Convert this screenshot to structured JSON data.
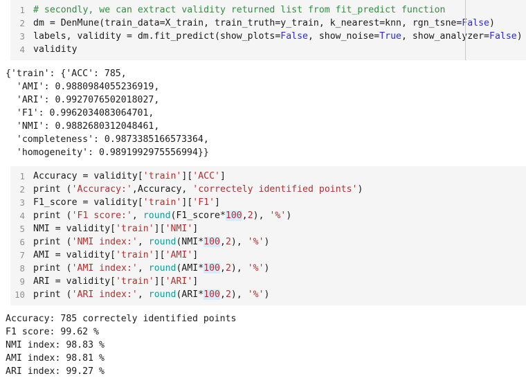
{
  "notebook": {
    "cells": [
      {
        "type": "code",
        "name": "code-cell-1",
        "has_ruler": true,
        "lines": [
          {
            "number": "1",
            "tokens": [
              {
                "t": "# secondly, we can extract validity returned list from fit_predict function",
                "c": "com"
              }
            ]
          },
          {
            "number": "2",
            "tokens": [
              {
                "t": "dm = DenMune(train_data=X_train, train_truth=y_train, k_nearest=knn, rgn_tsne=",
                "c": "pl"
              },
              {
                "t": "False",
                "c": "kw"
              },
              {
                "t": ")",
                "c": "pl"
              }
            ]
          },
          {
            "number": "3",
            "tokens": [
              {
                "t": "labels, validity = dm.fit_predict(show_plots=",
                "c": "pl"
              },
              {
                "t": "False",
                "c": "kw"
              },
              {
                "t": ", show_noise=",
                "c": "pl"
              },
              {
                "t": "True",
                "c": "kw"
              },
              {
                "t": ", show_analyzer=",
                "c": "pl"
              },
              {
                "t": "False",
                "c": "kw"
              },
              {
                "t": ")",
                "c": "pl"
              }
            ]
          },
          {
            "number": "4",
            "tokens": [
              {
                "t": "validity",
                "c": "pl"
              }
            ]
          }
        ]
      },
      {
        "type": "output",
        "name": "output-1",
        "lines": [
          "{'train': {'ACC': 785,",
          "  'AMI': 0.9880984055236919,",
          "  'ARI': 0.9927076502018027,",
          "  'F1': 0.9962034083064701,",
          "  'NMI': 0.9882680312048461,",
          "  'completeness': 0.9873385166573364,",
          "  'homogeneity': 0.9891992975556994}}"
        ]
      },
      {
        "type": "code",
        "name": "code-cell-2",
        "has_ruler": false,
        "lines": [
          {
            "number": "1",
            "tokens": [
              {
                "t": "Accuracy = validity[",
                "c": "pl"
              },
              {
                "t": "'train'",
                "c": "str"
              },
              {
                "t": "][",
                "c": "pl"
              },
              {
                "t": "'ACC'",
                "c": "str"
              },
              {
                "t": "]",
                "c": "pl"
              }
            ]
          },
          {
            "number": "2",
            "tokens": [
              {
                "t": "print (",
                "c": "pl"
              },
              {
                "t": "'Accuracy:'",
                "c": "str"
              },
              {
                "t": ",Accuracy, ",
                "c": "pl"
              },
              {
                "t": "'correctely identified points'",
                "c": "str"
              },
              {
                "t": ")",
                "c": "pl"
              }
            ]
          },
          {
            "number": "3",
            "tokens": [
              {
                "t": "F1_score = validity[",
                "c": "pl"
              },
              {
                "t": "'train'",
                "c": "str"
              },
              {
                "t": "][",
                "c": "pl"
              },
              {
                "t": "'F1'",
                "c": "str"
              },
              {
                "t": "]",
                "c": "pl"
              }
            ]
          },
          {
            "number": "4",
            "tokens": [
              {
                "t": "print (",
                "c": "pl"
              },
              {
                "t": "'F1 score:'",
                "c": "str"
              },
              {
                "t": ", ",
                "c": "pl"
              },
              {
                "t": "round",
                "c": "bi"
              },
              {
                "t": "(F1_score*",
                "c": "pl"
              },
              {
                "t": "100",
                "c": "num-hl"
              },
              {
                "t": ",",
                "c": "pl"
              },
              {
                "t": "2",
                "c": "num"
              },
              {
                "t": "), ",
                "c": "pl"
              },
              {
                "t": "'%'",
                "c": "str"
              },
              {
                "t": ")",
                "c": "pl"
              }
            ]
          },
          {
            "number": "5",
            "tokens": [
              {
                "t": "NMI = validity[",
                "c": "pl"
              },
              {
                "t": "'train'",
                "c": "str"
              },
              {
                "t": "][",
                "c": "pl"
              },
              {
                "t": "'NMI'",
                "c": "str"
              },
              {
                "t": "]",
                "c": "pl"
              }
            ]
          },
          {
            "number": "6",
            "tokens": [
              {
                "t": "print (",
                "c": "pl"
              },
              {
                "t": "'NMI index:'",
                "c": "str"
              },
              {
                "t": ", ",
                "c": "pl"
              },
              {
                "t": "round",
                "c": "bi"
              },
              {
                "t": "(NMI*",
                "c": "pl"
              },
              {
                "t": "100",
                "c": "num-hl"
              },
              {
                "t": ",",
                "c": "pl"
              },
              {
                "t": "2",
                "c": "num"
              },
              {
                "t": "), ",
                "c": "pl"
              },
              {
                "t": "'%'",
                "c": "str"
              },
              {
                "t": ")",
                "c": "pl"
              }
            ]
          },
          {
            "number": "7",
            "tokens": [
              {
                "t": "AMI = validity[",
                "c": "pl"
              },
              {
                "t": "'train'",
                "c": "str"
              },
              {
                "t": "][",
                "c": "pl"
              },
              {
                "t": "'AMI'",
                "c": "str"
              },
              {
                "t": "]",
                "c": "pl"
              }
            ]
          },
          {
            "number": "8",
            "tokens": [
              {
                "t": "print (",
                "c": "pl"
              },
              {
                "t": "'AMI index:'",
                "c": "str"
              },
              {
                "t": ", ",
                "c": "pl"
              },
              {
                "t": "round",
                "c": "bi"
              },
              {
                "t": "(AMI*",
                "c": "pl"
              },
              {
                "t": "100",
                "c": "num-hl"
              },
              {
                "t": ",",
                "c": "pl"
              },
              {
                "t": "2",
                "c": "num"
              },
              {
                "t": "), ",
                "c": "pl"
              },
              {
                "t": "'%'",
                "c": "str"
              },
              {
                "t": ")",
                "c": "pl"
              }
            ]
          },
          {
            "number": "9",
            "tokens": [
              {
                "t": "ARI = validity[",
                "c": "pl"
              },
              {
                "t": "'train'",
                "c": "str"
              },
              {
                "t": "][",
                "c": "pl"
              },
              {
                "t": "'ARI'",
                "c": "str"
              },
              {
                "t": "]",
                "c": "pl"
              }
            ]
          },
          {
            "number": "10",
            "tokens": [
              {
                "t": "print (",
                "c": "pl"
              },
              {
                "t": "'ARI index:'",
                "c": "str"
              },
              {
                "t": ", ",
                "c": "pl"
              },
              {
                "t": "round",
                "c": "bi"
              },
              {
                "t": "(ARI*",
                "c": "pl"
              },
              {
                "t": "100",
                "c": "num-hl"
              },
              {
                "t": ",",
                "c": "pl"
              },
              {
                "t": "2",
                "c": "num"
              },
              {
                "t": "), ",
                "c": "pl"
              },
              {
                "t": "'%'",
                "c": "str"
              },
              {
                "t": ")",
                "c": "pl"
              }
            ]
          }
        ]
      },
      {
        "type": "output",
        "name": "output-2",
        "lines": [
          "Accuracy: 785 correctely identified points",
          "F1 score: 99.62 %",
          "NMI index: 98.83 %",
          "AMI index: 98.81 %",
          "ARI index: 99.27 %"
        ]
      }
    ]
  },
  "colors": {
    "cell_bg": "#f5f5f5",
    "page_bg": "#ffffff",
    "comment": "#2f8f3f",
    "string": "#b03030",
    "keyword": "#2b2bd8",
    "builtin": "#139999",
    "highlight": "#d6ecfa",
    "lineno": "#8f8f8f",
    "text": "#1a1a1a",
    "ruler": "#c9c9c9"
  }
}
